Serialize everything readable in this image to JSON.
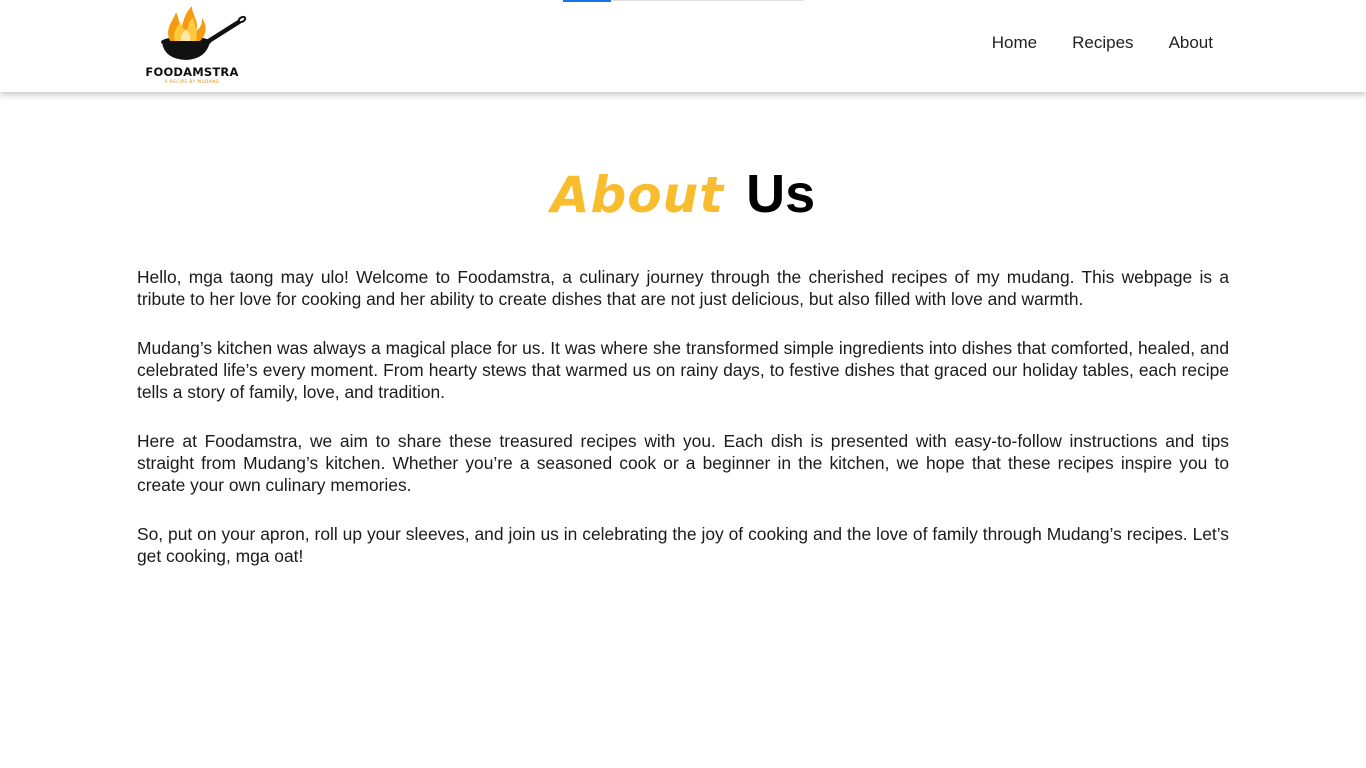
{
  "header": {
    "logo": {
      "brand": "FOODAMSTRA",
      "tagline": "A RECIPE BY MUDANG"
    },
    "nav": [
      {
        "label": "Home"
      },
      {
        "label": "Recipes"
      },
      {
        "label": "About"
      }
    ],
    "progress": {
      "value_percent": 20,
      "color": "#1a73e8"
    }
  },
  "main": {
    "title_accent": "About",
    "title_main": "Us",
    "accent_color": "#f7bd2f",
    "paragraphs": [
      "Hello, mga taong may ulo! Welcome to Foodamstra, a culinary journey through the cherished recipes of my mudang. This webpage is a tribute to her love for cooking and her ability to create dishes that are not just delicious, but also filled with love and warmth.",
      "Mudang’s kitchen was always a magical place for us. It was where she transformed simple ingredients into dishes that comforted, healed, and celebrated life’s every moment. From hearty stews that warmed us on rainy days, to festive dishes that graced our holiday tables, each recipe tells a story of family, love, and tradition.",
      "Here at Foodamstra, we aim to share these treasured recipes with you. Each dish is presented with easy-to-follow instructions and tips straight from Mudang’s kitchen. Whether you’re a seasoned cook or a beginner in the kitchen, we hope that these recipes inspire you to create your own culinary memories.",
      "So, put on your apron, roll up your sleeves, and join us in celebrating the joy of cooking and the love of family through Mudang’s recipes. Let’s get cooking, mga oat!"
    ]
  }
}
